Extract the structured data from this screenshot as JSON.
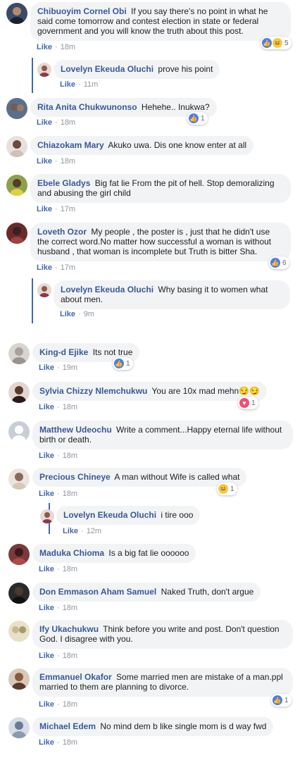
{
  "like_label": "Like",
  "comments": [
    {
      "name": "Chibuoyim Cornel Obi",
      "text": "If you say there's no point in what he said come tomorrow and contest election in state or federal government and you will know the truth about this post.",
      "time": "18m",
      "reactions": [
        "like",
        "haha"
      ],
      "reaction_count": "5",
      "avatar_color": "#3b4a6b"
    },
    {
      "name": "Lovelyn Ekeuda Oluchi",
      "text": "prove his point",
      "time": "11m",
      "reply": true,
      "avatar_color": "#8a5a4a"
    },
    {
      "name": "Rita Anita Chukwunonso",
      "text": "Hehehe.. Inukwa?",
      "time": "18m",
      "reactions": [
        "like"
      ],
      "reaction_count": "1",
      "avatar_color": "#5a6f8a"
    },
    {
      "name": "Chiazokam Mary",
      "text": "Akuko uwa. Dis one know enter at all",
      "time": "18m",
      "avatar_color": "#d9c8c0"
    },
    {
      "name": "Ebele Gladys",
      "text": "Big fat lie From the pit of hell. Stop demoralizing and abusing the girl child",
      "time": "17m",
      "avatar_color": "#8ba24a"
    },
    {
      "name": "Loveth Ozor",
      "text": "My people , the poster is , just that he didn't use the correct word.No matter how successful a woman is without husband , that woman is incomplete but Truth is bitter Sha.",
      "time": "17m",
      "reactions": [
        "like"
      ],
      "reaction_count": "6",
      "avatar_color": "#6a2a2a"
    },
    {
      "name": "Lovelyn Ekeuda Oluchi",
      "text": "Why basing it to women what about men.",
      "time": "9m",
      "reply": true,
      "avatar_color": "#8a5a4a"
    },
    {
      "name": "King-d Ejike",
      "text": "Its not true",
      "time": "19m",
      "reactions": [
        "like"
      ],
      "reaction_count": "1",
      "avatar_color": "#a8a09a"
    },
    {
      "name": "Sylvia Chizzy Nlemchukwu",
      "text": "You are 10x mad mehn😏😏",
      "time": "18m",
      "reactions": [
        "love"
      ],
      "reaction_count": "1",
      "avatar_color": "#5a3a2a"
    },
    {
      "name": "Matthew Udeochu",
      "text": "Write a comment...Happy eternal life without birth or death.",
      "time": "18m",
      "avatar_color": "#c9ced6"
    },
    {
      "name": "Precious Chineye",
      "text": "A man without Wife is called what",
      "time": "18m",
      "reactions": [
        "haha"
      ],
      "reaction_count": "1",
      "avatar_color": "#d6c8b8"
    },
    {
      "name": "Lovelyn Ekeuda Oluchi",
      "text": "i tire ooo",
      "time": "12m",
      "reply": true,
      "avatar_color": "#8a5a4a"
    },
    {
      "name": "Maduka Chioma",
      "text": "Is a big fat lie oooooo",
      "time": "18m",
      "avatar_color": "#7a3a3a"
    },
    {
      "name": "Don Emmason Aham Samuel",
      "text": "Naked Truth, don't argue",
      "time": "18m",
      "avatar_color": "#2a2a2a"
    },
    {
      "name": "Ify Ukachukwu",
      "text": "Think before you write and post. Don't question God. I disagree with you.",
      "time": "18m",
      "avatar_color": "#c8b890"
    },
    {
      "name": "Emmanuel Okafor",
      "text": "Some married men are mistake of a man.ppl married to them are planning to divorce.",
      "time": "18m",
      "reactions": [
        "like"
      ],
      "reaction_count": "1",
      "avatar_color": "#8a5a3a"
    },
    {
      "name": "Michael Edem",
      "text": "No mind dem b like single mom is d way fwd",
      "time": "18m",
      "avatar_color": "#6a7a9a"
    }
  ]
}
